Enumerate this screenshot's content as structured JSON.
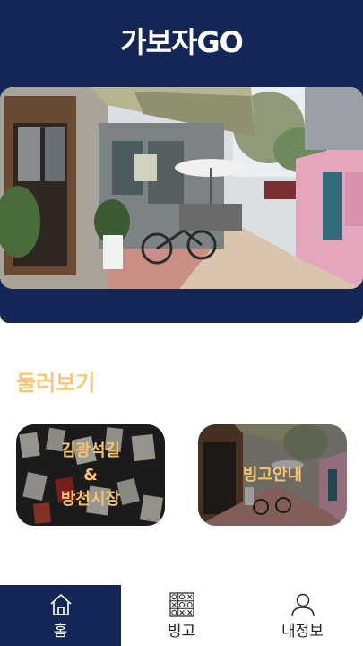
{
  "header": {
    "title": "가보자GO"
  },
  "hero": {
    "image_alt": ""
  },
  "section": {
    "title": "둘러보기"
  },
  "cards": [
    {
      "label": "김광석길\n&\n방천시장",
      "icon": "photo-mural"
    },
    {
      "label": "빙고안내",
      "icon": "photo-alley"
    }
  ],
  "tabs": [
    {
      "label": "홈",
      "icon": "home-icon",
      "active": true
    },
    {
      "label": "빙고",
      "icon": "bingo-grid-icon",
      "active": false
    },
    {
      "label": "내정보",
      "icon": "user-icon",
      "active": false
    }
  ],
  "colors": {
    "navy": "#132655",
    "accent": "#f5c97a",
    "white": "#ffffff"
  }
}
